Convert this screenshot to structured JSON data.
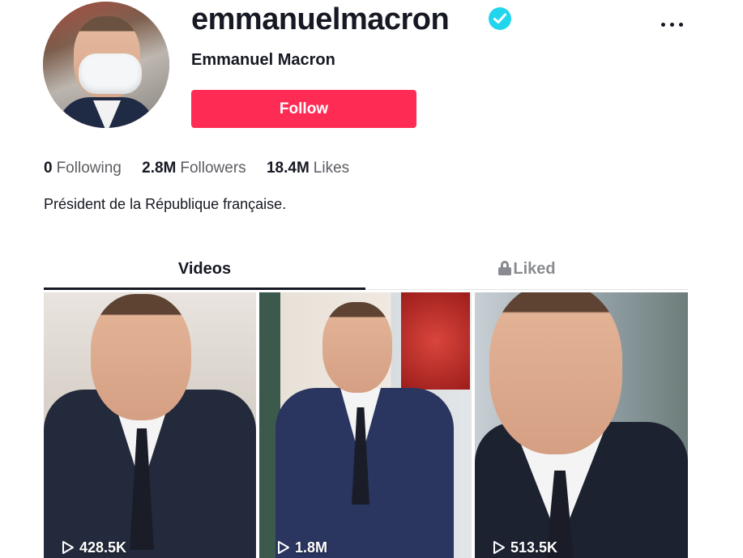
{
  "profile": {
    "username": "emmanuelmacron",
    "display_name": "Emmanuel Macron",
    "verified": true,
    "follow_label": "Follow",
    "bio": "Président de la République française.",
    "avatar_icon": "profile-photo"
  },
  "stats": {
    "following_count": "0",
    "following_label": "Following",
    "followers_count": "2.8M",
    "followers_label": "Followers",
    "likes_count": "18.4M",
    "likes_label": "Likes"
  },
  "tabs": {
    "videos": "Videos",
    "liked": "Liked"
  },
  "videos": [
    {
      "views": "428.5K"
    },
    {
      "views": "1.8M"
    },
    {
      "views": "513.5K"
    }
  ],
  "colors": {
    "accent": "#fe2c55",
    "verified": "#20d5ec",
    "text": "#161823",
    "muted": "#5c5c63"
  }
}
